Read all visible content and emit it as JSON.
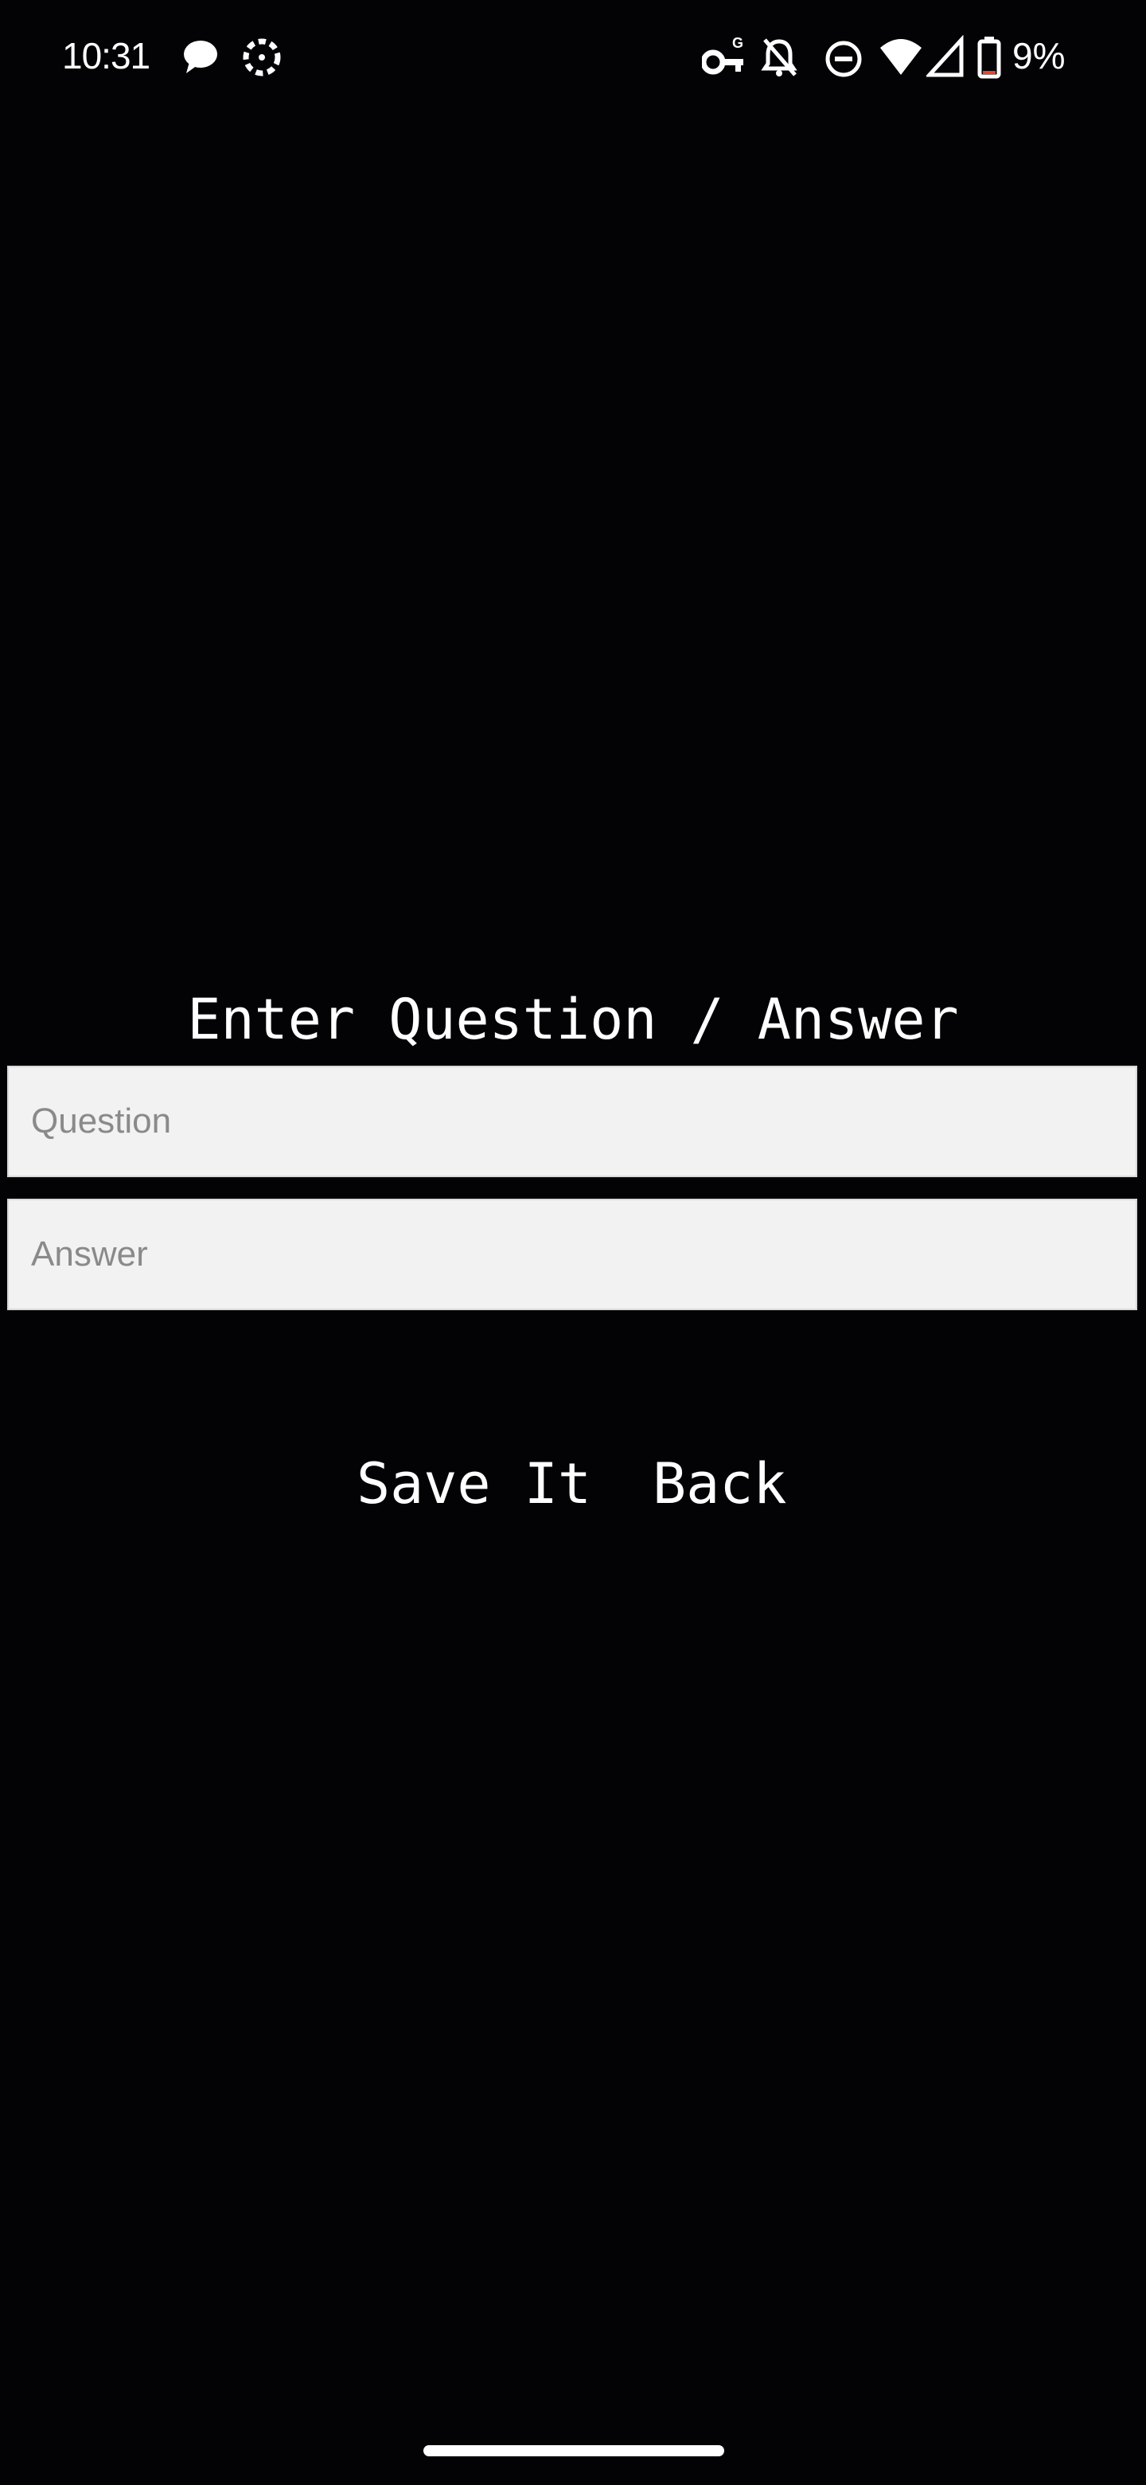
{
  "status_bar": {
    "time": "10:31",
    "battery_percent": "9%",
    "icons": [
      "chat-bubble-icon",
      "dashed-circle-icon",
      "vpn-key-icon",
      "notifications-off-icon",
      "do-not-disturb-icon",
      "wifi-icon",
      "signal-icon",
      "battery-icon"
    ]
  },
  "form": {
    "title": "Enter Question / Answer",
    "question": {
      "placeholder": "Question",
      "value": ""
    },
    "answer": {
      "placeholder": "Answer",
      "value": ""
    },
    "save_label": "Save It",
    "back_label": "Back"
  },
  "colors": {
    "background": "#030305",
    "text": "#ffffff",
    "field_background": "#f2f2f2",
    "placeholder": "#8a8a8a"
  }
}
